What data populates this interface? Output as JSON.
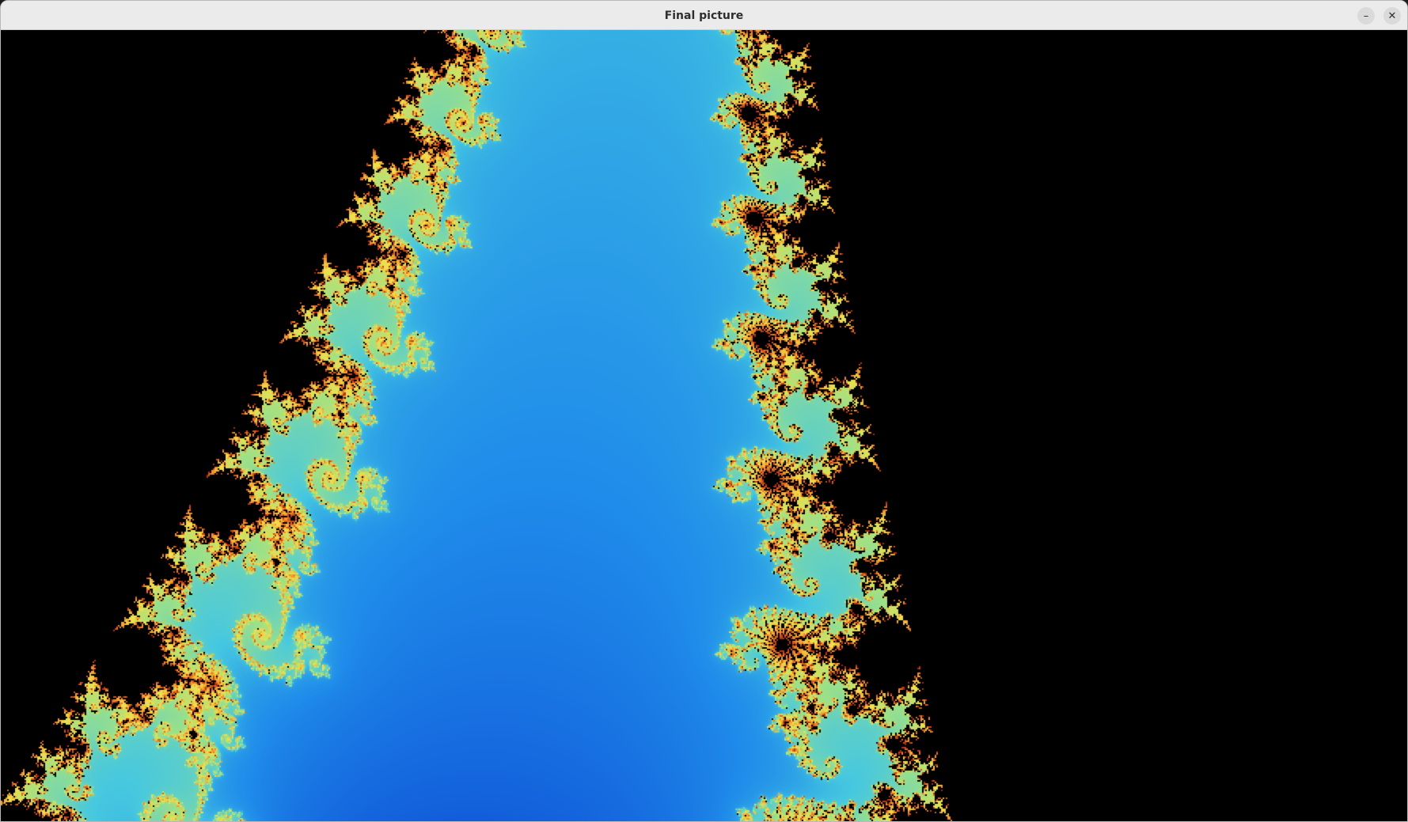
{
  "window": {
    "title": "Final picture",
    "controls": {
      "minimize_icon": "minimize-icon",
      "close_icon": "close-icon"
    }
  },
  "fractal": {
    "type": "mandelbrot",
    "palette": {
      "interior": "#000000",
      "outer": "#0a3fd0",
      "mid": "#1f8cea",
      "cyan": "#46c8e0",
      "green": "#9ae08a",
      "yellow": "#f2e04a",
      "orange": "#f08a2a",
      "red": "#a8200a"
    }
  }
}
